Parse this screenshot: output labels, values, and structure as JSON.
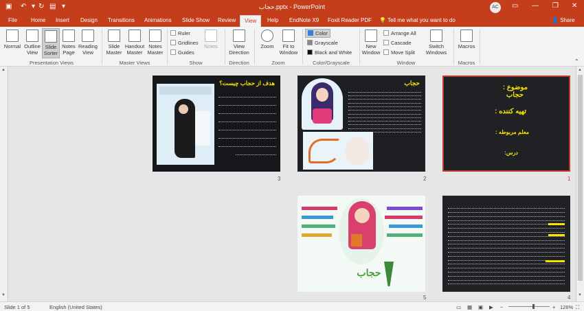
{
  "titlebar": {
    "title": "حجاب.pptx - PowerPoint",
    "user_initials": "AC"
  },
  "tabs": [
    "File",
    "Home",
    "Insert",
    "Design",
    "Transitions",
    "Animations",
    "Slide Show",
    "Review",
    "View",
    "Help",
    "EndNote X9",
    "Foxit Reader PDF"
  ],
  "active_tab": "View",
  "tellme": "Tell me what you want to do",
  "share": "Share",
  "ribbon": {
    "presentation_views": {
      "label": "Presentation Views",
      "normal": "Normal",
      "outline": "Outline View",
      "slide_sorter": "Slide Sorter",
      "notes_page": "Notes Page",
      "reading": "Reading View"
    },
    "master_views": {
      "label": "Master Views",
      "slide_master": "Slide Master",
      "handout_master": "Handout Master",
      "notes_master": "Notes Master"
    },
    "show": {
      "label": "Show",
      "ruler": "Ruler",
      "gridlines": "Gridlines",
      "guides": "Guides",
      "notes": "Notes"
    },
    "direction": {
      "label": "Direction",
      "view_direction": "View Direction"
    },
    "zoom": {
      "label": "Zoom",
      "zoom": "Zoom",
      "fit": "Fit to Window"
    },
    "color": {
      "label": "Color/Grayscale",
      "color": "Color",
      "grayscale": "Grayscale",
      "bw": "Black and White"
    },
    "window": {
      "label": "Window",
      "new_window": "New Window",
      "arrange": "Arrange All",
      "cascade": "Cascade",
      "move_split": "Move Split",
      "switch": "Switch Windows"
    },
    "macros": {
      "label": "Macros",
      "macros": "Macros"
    }
  },
  "slides": {
    "s1": {
      "num": "1",
      "l1": "موضوع :",
      "l2": "حجاب",
      "l3": "تهیه کننده :",
      "l4": "معلم مربوطه :",
      "l5": "درس:"
    },
    "s2": {
      "num": "2",
      "title": "حجاب"
    },
    "s3": {
      "num": "3",
      "title": "هدف از حجاب چیست؟"
    },
    "s4": {
      "num": "4"
    },
    "s5": {
      "num": "5"
    }
  },
  "status": {
    "slide": "Slide 1 of 5",
    "lang": "English (United States)",
    "zoom": "126%"
  },
  "colors": {
    "accent": "#c43e1c",
    "title_yellow": "#f5e400"
  }
}
